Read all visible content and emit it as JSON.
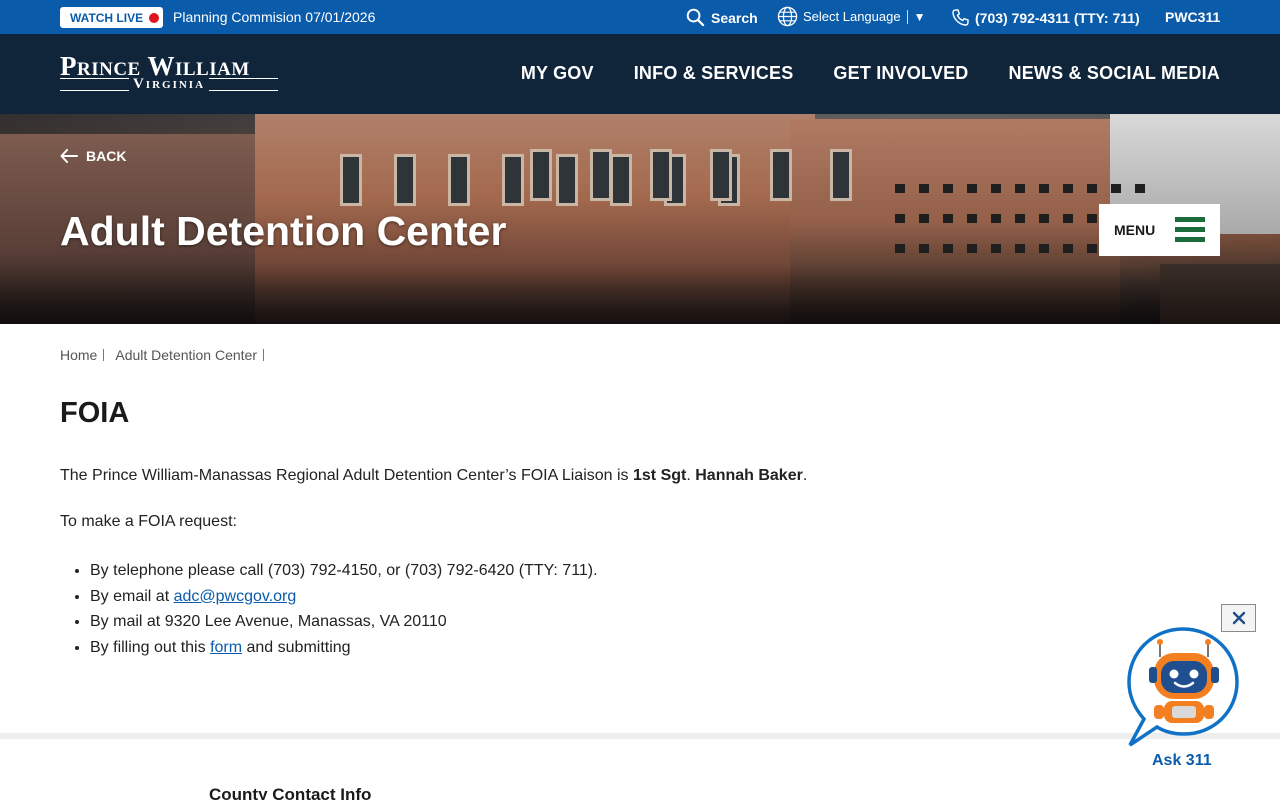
{
  "topbar": {
    "watch_live": "WATCH LIVE",
    "live_event": "Planning Commision 07/01/2026",
    "search_label": "Search",
    "language_label": "Select Language",
    "language_caret": "▼",
    "phone": "(703) 792-4311 (TTY: 711)",
    "pwc311": "PWC311"
  },
  "header": {
    "logo_main": "Prince William",
    "logo_sub": "Virginia",
    "nav": [
      "MY GOV",
      "INFO & SERVICES",
      "GET INVOLVED",
      "NEWS & SOCIAL MEDIA"
    ]
  },
  "hero": {
    "back_label": "BACK",
    "title": "Adult Detention Center",
    "menu_label": "MENU"
  },
  "breadcrumb": [
    "Home",
    "Adult Detention Center"
  ],
  "main": {
    "heading": "FOIA",
    "intro_prefix": "The Prince William-Manassas Regional Adult Detention Center’s FOIA Liaison is ",
    "liaison_rank": "1st Sgt",
    "liaison_sep": ". ",
    "liaison_name": "Hannah Baker",
    "intro_suffix": ".",
    "request_lead": "To make a FOIA request:",
    "items": {
      "phone": "By telephone please call (703) 792-4150, or (703) 792-6420 (TTY: 711).",
      "email_prefix": "By email at ",
      "email_link": "adc@pwcgov.org",
      "mail": "By mail at 9320 Lee Avenue, Manassas, VA 20110",
      "form_prefix": "By filling out this ",
      "form_link": "form",
      "form_suffix": " and submitting"
    }
  },
  "footer": {
    "heading": "County Contact Info"
  },
  "chatbot": {
    "label": "Ask 311"
  },
  "colors": {
    "topbar": "#0a5cab",
    "navbar": "#10243a",
    "menu_icon": "#1c6b3a",
    "link": "#0a5cab",
    "live_dot": "#e0141e"
  },
  "icons": [
    "search-icon",
    "globe-icon",
    "phone-icon",
    "back-arrow-icon",
    "hamburger-icon",
    "close-icon",
    "robot-icon"
  ]
}
